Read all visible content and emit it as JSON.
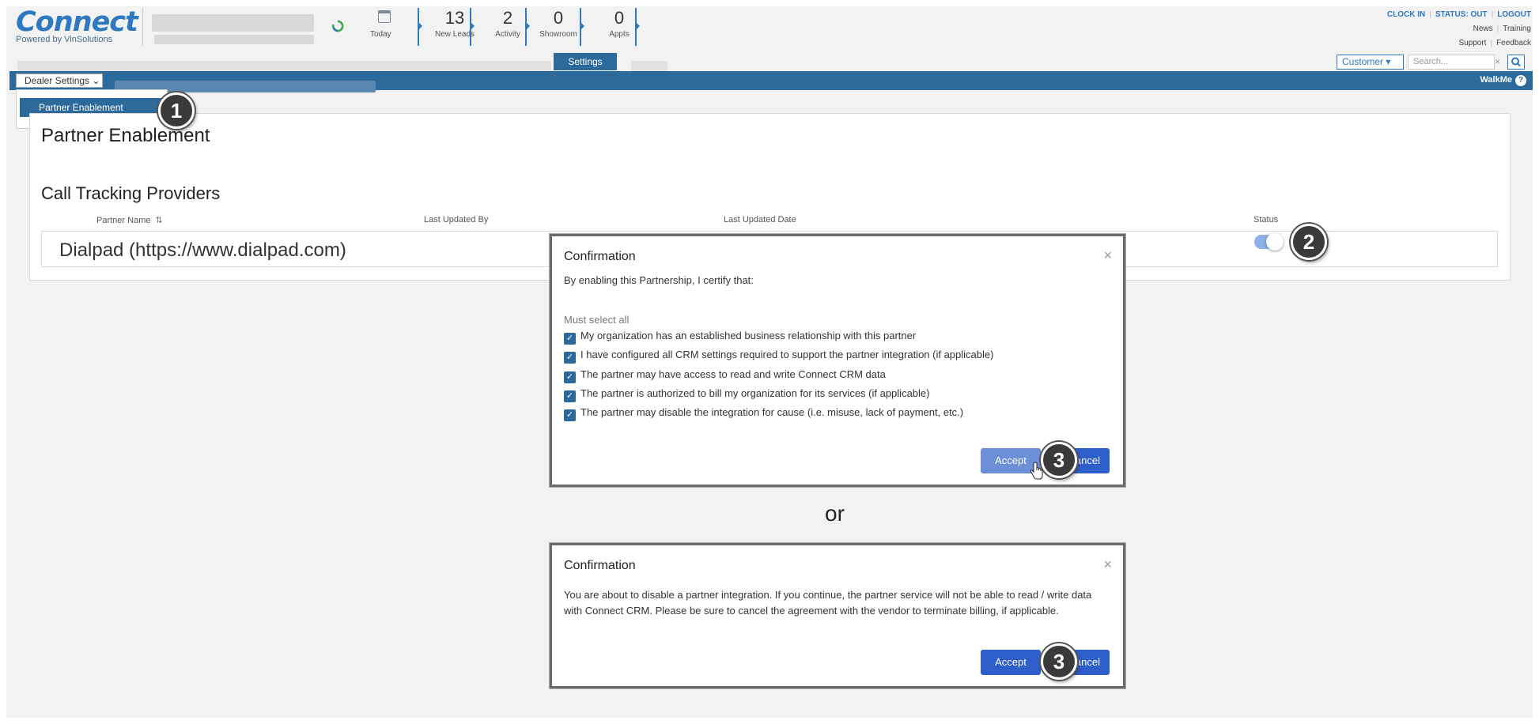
{
  "header": {
    "logo_title": "Connect",
    "logo_sub": "Powered by VinSolutions",
    "stats": [
      {
        "value": "",
        "label": "Today"
      },
      {
        "value": "13",
        "label": "New Leads"
      },
      {
        "value": "2",
        "label": "Activity"
      },
      {
        "value": "0",
        "label": "Showroom"
      },
      {
        "value": "0",
        "label": "Appts"
      }
    ],
    "links": {
      "clock_in": "CLOCK IN",
      "status": "STATUS: OUT",
      "logout": "LOGOUT",
      "news": "News",
      "training": "Training",
      "support": "Support",
      "feedback": "Feedback"
    }
  },
  "nav": {
    "active_tab": "Settings",
    "customer_select": "Customer",
    "search_placeholder": "Search...",
    "dealer_settings": "Dealer Settings",
    "walkme": "WalkMe",
    "dropdown_item": "Partner Enablement"
  },
  "page": {
    "title": "Partner Enablement",
    "section_title": "Call Tracking Providers",
    "columns": [
      "Partner Name",
      "Last Updated By",
      "Last Updated Date",
      "Status"
    ],
    "rows": [
      {
        "partner_name": "Dialpad (https://www.dialpad.com)",
        "status": "enabled"
      }
    ]
  },
  "callouts": [
    "1",
    "2",
    "3",
    "3"
  ],
  "modal_enable": {
    "title": "Confirmation",
    "intro": "By enabling this Partnership, I certify that:",
    "must": "Must select all",
    "items": [
      "My organization has an established business relationship with this partner",
      "I have configured all CRM settings required to support the partner integration (if applicable)",
      "The partner may have access to read and write Connect CRM data",
      "The partner is authorized to bill my organization for its services (if applicable)",
      "The partner may disable the integration for cause (i.e. misuse, lack of payment, etc.)"
    ],
    "accept": "Accept",
    "cancel": "Cancel"
  },
  "or_label": "or",
  "modal_disable": {
    "title": "Confirmation",
    "body": "You are about to disable a partner integration. If you continue, the partner service will not be able to read / write data with Connect CRM. Please be sure to cancel the agreement with the vendor to terminate billing, if applicable.",
    "accept": "Accept",
    "cancel": "Cancel"
  },
  "colors": {
    "brand_blue": "#2d6a9c",
    "logo_blue": "#2e79c0",
    "button_blue": "#2d5ec9",
    "toggle_on": "#8fb0e6"
  }
}
